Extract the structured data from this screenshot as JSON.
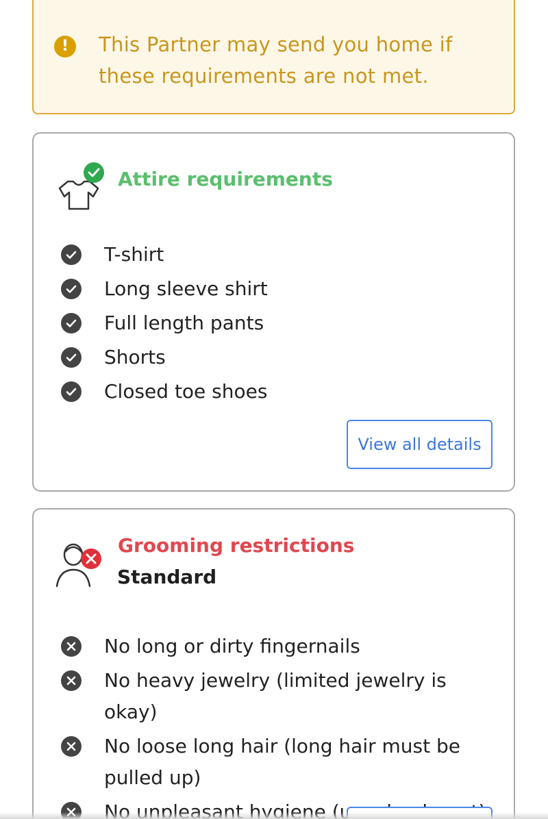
{
  "warning": {
    "icon": "exclamation-icon",
    "text": "This Partner may send you home if these requirements are not met."
  },
  "attire": {
    "title": "Attire requirements",
    "icon": "tshirt-check-icon",
    "items": [
      {
        "label": "T-shirt",
        "status": "allowed"
      },
      {
        "label": "Long sleeve shirt",
        "status": "allowed"
      },
      {
        "label": "Full length pants",
        "status": "allowed"
      },
      {
        "label": "Shorts",
        "status": "allowed"
      },
      {
        "label": "Closed toe shoes",
        "status": "allowed"
      }
    ],
    "button_label": "View all details"
  },
  "grooming": {
    "title": "Grooming restrictions",
    "subtitle": "Standard",
    "icon": "person-x-icon",
    "items": [
      {
        "label": "No long or dirty fingernails",
        "status": "restricted"
      },
      {
        "label": "No heavy jewelry (limited jewelry is okay)",
        "status": "restricted"
      },
      {
        "label": "No loose long hair (long hair must be pulled up)",
        "status": "restricted"
      },
      {
        "label": "No unpleasant hygiene (use deodorant)",
        "status": "restricted"
      }
    ]
  },
  "colors": {
    "warning_text": "#c9961c",
    "warning_bg": "#fdf7e8",
    "attire_accent": "#5bbf6e",
    "grooming_accent": "#e0484f",
    "button_accent": "#3a78d8"
  }
}
